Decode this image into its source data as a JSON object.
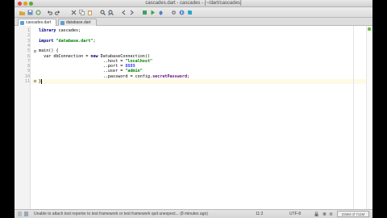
{
  "window": {
    "title": "cascades.dart - cascades - [~/dart/cascades]"
  },
  "toolbar": {
    "icons": [
      "open-icon",
      "save-icon",
      "sync-icon",
      "undo-icon",
      "redo-icon",
      "cut-icon",
      "copy-icon",
      "paste-icon",
      "find-icon",
      "replace-icon",
      "back-icon",
      "forward-icon",
      "build-icon",
      "run-icon",
      "debug-icon",
      "settings-icon",
      "help-icon",
      "dart-icon"
    ]
  },
  "tabs": [
    {
      "label": "cascades.dart",
      "active": true
    },
    {
      "label": "database.dart",
      "active": false
    }
  ],
  "editor": {
    "line_numbers": [
      "1",
      "2",
      "3",
      "4",
      "5",
      "6",
      "7",
      "8",
      "9",
      "10",
      "11"
    ],
    "code": {
      "l1_kw": "library",
      "l1_rest": " cascades;",
      "l3_kw": "import",
      "l3_str": "\"database.dart\"",
      "l3_end": ";",
      "l5": "main() {",
      "l6_a": "  var dbConnection = ",
      "l6_kw": "new",
      "l6_b": " DatabaseConnection()",
      "l7_a": "                          ..host = ",
      "l7_str": "\"localhost\"",
      "l8_a": "                          ..port = ",
      "l8_num": "8889",
      "l9_a": "                          ..user = ",
      "l9_str": "\"admin\"",
      "l10_a": "                          ..password = config.",
      "l10_fld": "secretPassword",
      "l10_end": ";",
      "l11": "}"
    }
  },
  "status": {
    "message": "Unable to attach test reporter to test framework or test framework quit unexpect... (8 minutes ago)",
    "position": "11:2",
    "encoding": "UTF-8",
    "memory": "234M of 711M"
  },
  "colors": {
    "close": "#e0443e",
    "minimize": "#dea123",
    "maximize": "#5aa83a",
    "keyword": "#000080",
    "string": "#008000",
    "number": "#0000ff",
    "field": "#660e7a",
    "caret_line": "#fffae3"
  }
}
